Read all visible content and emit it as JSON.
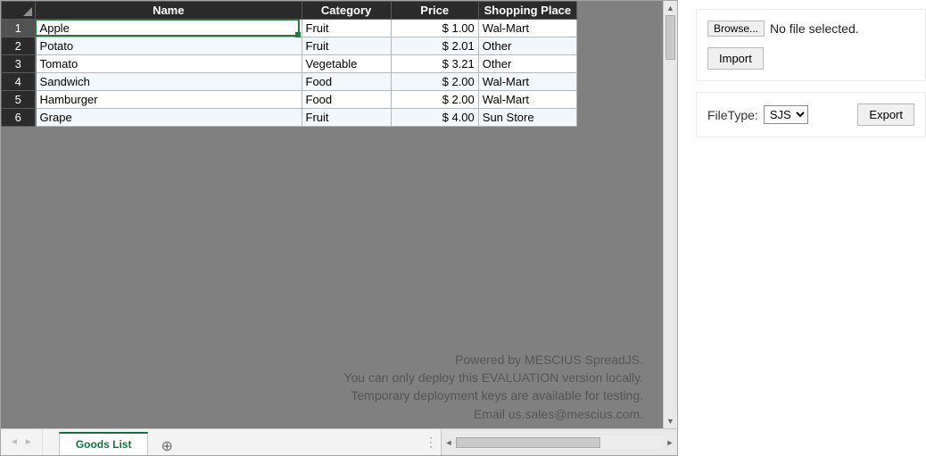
{
  "sheet": {
    "tab_name": "Goods List",
    "headers": {
      "name": "Name",
      "category": "Category",
      "price": "Price",
      "shopping_place": "Shopping Place"
    },
    "row_numbers": [
      "1",
      "2",
      "3",
      "4",
      "5",
      "6"
    ],
    "rows": [
      {
        "name": "Apple",
        "category": "Fruit",
        "price": "$ 1.00",
        "shop": "Wal-Mart"
      },
      {
        "name": "Potato",
        "category": "Fruit",
        "price": "$ 2.01",
        "shop": "Other"
      },
      {
        "name": "Tomato",
        "category": "Vegetable",
        "price": "$ 3.21",
        "shop": "Other"
      },
      {
        "name": "Sandwich",
        "category": "Food",
        "price": "$ 2.00",
        "shop": "Wal-Mart"
      },
      {
        "name": "Hamburger",
        "category": "Food",
        "price": "$ 2.00",
        "shop": "Wal-Mart"
      },
      {
        "name": "Grape",
        "category": "Fruit",
        "price": "$ 4.00",
        "shop": "Sun Store"
      }
    ],
    "active_row_index": 0
  },
  "watermark": {
    "line1": "Powered by MESCIUS SpreadJS.",
    "line2": "You can only deploy this EVALUATION version locally.",
    "line3": "Temporary deployment keys are available for testing.",
    "line4": "Email us.sales@mescius.com."
  },
  "controls": {
    "browse_label": "Browse...",
    "file_status": "No file selected.",
    "import_label": "Import",
    "filetype_label": "FileType:",
    "filetype_value": "SJS",
    "filetype_options": [
      "SJS"
    ],
    "export_label": "Export"
  }
}
